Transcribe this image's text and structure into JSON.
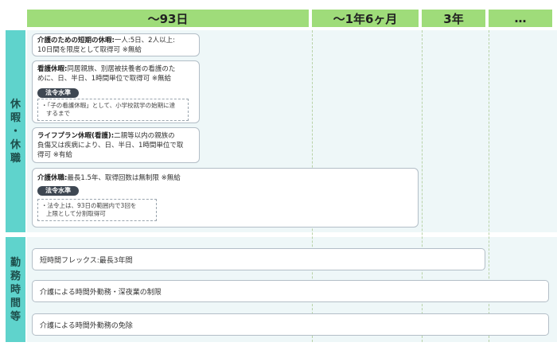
{
  "headers": [
    "〜93日",
    "〜1年6ヶ月",
    "3年",
    "…"
  ],
  "bands": {
    "leave": "休暇・休職",
    "leave_chars": [
      "休",
      "暇",
      "・",
      "休",
      "職"
    ],
    "work": "勤務時間等",
    "work_chars": [
      "勤",
      "務",
      "時",
      "間",
      "等"
    ]
  },
  "leave_boxes": {
    "short_leave": {
      "title": "介護のための短期の休暇:",
      "line1": "一人:5日、2人以上:",
      "line2": "10日間を限度として取得可 ※無給"
    },
    "nursing_leave": {
      "title": "看護休暇:",
      "line1": "同居親族、別居被扶養者の看護のた",
      "line2": "めに、日、半日、1時間単位で取得可 ※無給",
      "tag": "法令水準",
      "note1": "・「子の看護休暇」として、小学校就学の始期に達",
      "note2": "するまで"
    },
    "lifeplan_leave": {
      "title": "ライフプラン休暇(看護):",
      "line1": "二親等以内の親族の",
      "line2": "負傷又は疾病により、日、半日、1時間単位で取",
      "line3": "得可 ※有給"
    },
    "care_leave": {
      "title": "介護休職:",
      "line1": "最長1.5年、取得回数は無制限 ※無給",
      "tag": "法令水準",
      "note1": "・法令上は、93日の範囲内で3回を",
      "note2": "上限として分割取得可"
    }
  },
  "work_bars": {
    "flex": "短時間フレックス:最長3年間",
    "overtime_limit": "介護による時間外勤務・深夜業の制限",
    "overtime_exempt": "介護による時間外勤務の免除"
  },
  "colors": {
    "header_green": "#9fdc7a",
    "band_teal": "#5fd3cc",
    "tag_dark": "#3e4752"
  }
}
